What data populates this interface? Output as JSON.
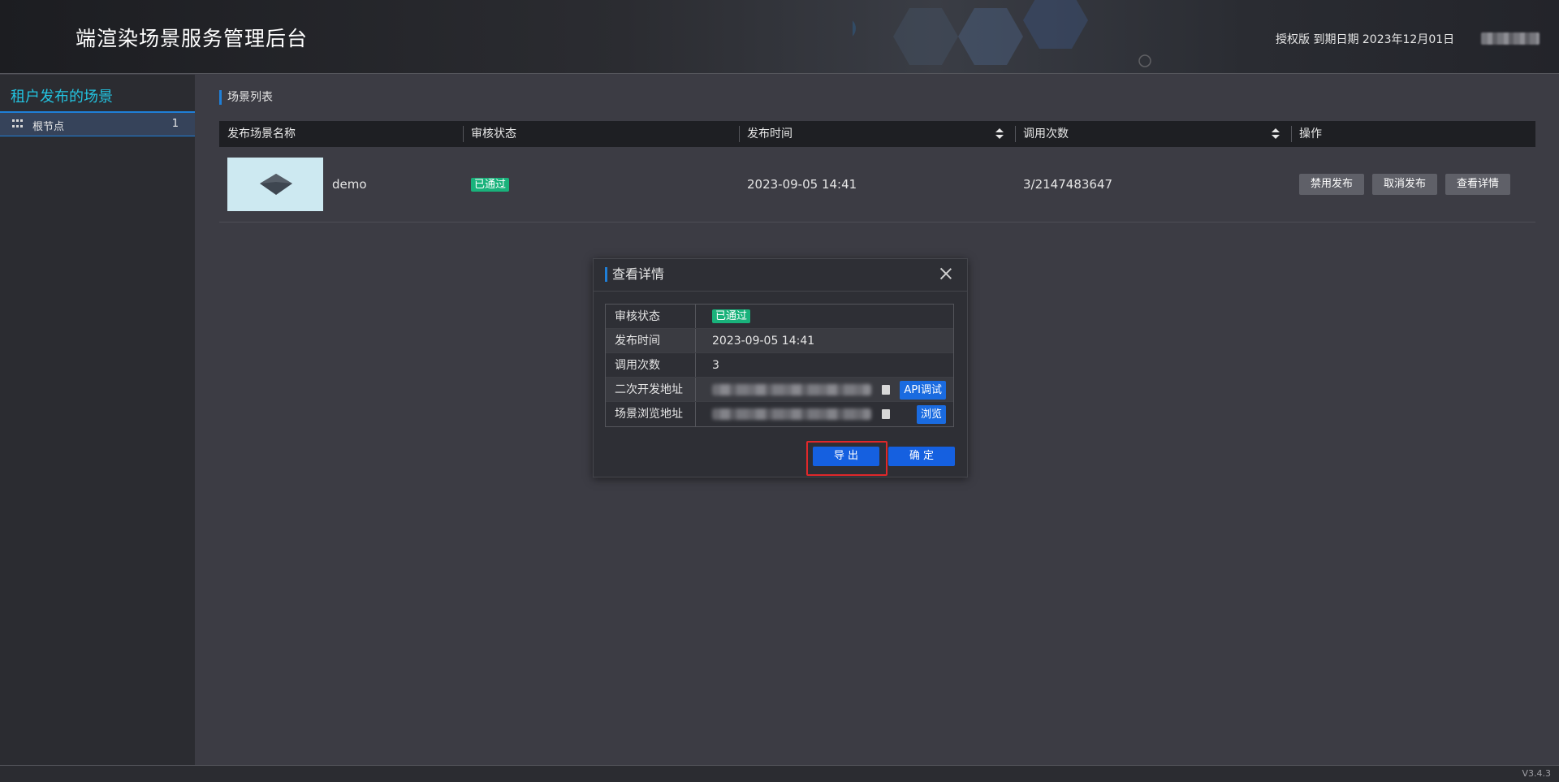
{
  "header": {
    "title": "端渲染场景服务管理后台",
    "license": "授权版 到期日期 2023年12月01日"
  },
  "sidebar": {
    "title": "租户发布的场景",
    "items": [
      {
        "label": "根节点",
        "count": "1",
        "icon": "grid-icon"
      }
    ]
  },
  "main": {
    "section_title": "场景列表",
    "columns": [
      "发布场景名称",
      "审核状态",
      "发布时间",
      "调用次数",
      "操作"
    ],
    "rows": [
      {
        "name": "demo",
        "status": "已通过",
        "publish_time": "2023-09-05 14:41",
        "calls": "3/2147483647",
        "actions": [
          "禁用发布",
          "取消发布",
          "查看详情"
        ]
      }
    ]
  },
  "modal": {
    "title": "查看详情",
    "rows": [
      {
        "label": "审核状态",
        "value": "已通过"
      },
      {
        "label": "发布时间",
        "value": "2023-09-05 14:41"
      },
      {
        "label": "调用次数",
        "value": "3"
      },
      {
        "label": "二次开发地址",
        "button": "API调试"
      },
      {
        "label": "场景浏览地址",
        "button": "浏览"
      }
    ],
    "export_label": "导 出",
    "confirm_label": "确 定"
  },
  "footer": {
    "version": "V3.4.3"
  },
  "colors": {
    "accent": "#1f7fd8",
    "cyan_title": "#23c3e0",
    "success": "#19b27b",
    "primary_button": "#1560e0",
    "highlight": "#e0282a"
  }
}
